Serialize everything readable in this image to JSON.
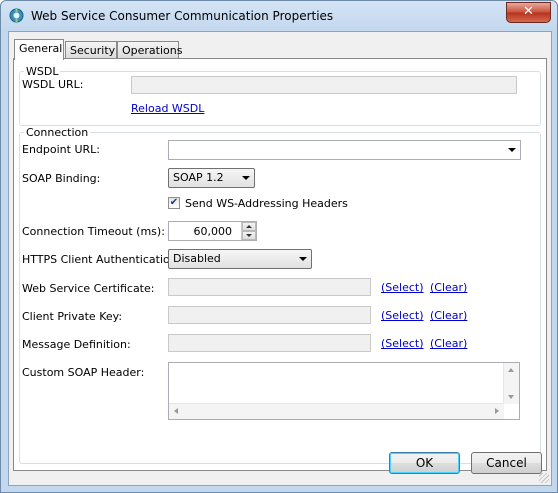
{
  "window": {
    "title": "Web Service Consumer Communication Properties",
    "close_label": "✕",
    "icon": "app-gear-icon"
  },
  "tabs": [
    {
      "label": "General",
      "active": true
    },
    {
      "label": "Security",
      "active": false
    },
    {
      "label": "Operations",
      "active": false
    }
  ],
  "wsdl": {
    "group_title": "WSDL",
    "url_label": "WSDL URL:",
    "url_value": "",
    "reload_link": "Reload WSDL"
  },
  "connection": {
    "group_title": "Connection",
    "endpoint_label": "Endpoint URL:",
    "endpoint_value": "",
    "soap_binding_label": "SOAP Binding:",
    "soap_binding_value": "SOAP 1.2",
    "ws_addressing_label": "Send WS-Addressing Headers",
    "ws_addressing_checked": true,
    "timeout_label": "Connection Timeout (ms):",
    "timeout_value": "60,000",
    "https_auth_label": "HTTPS Client Authentication:",
    "https_auth_value": "Disabled",
    "certificate_label": "Web Service Certificate:",
    "private_key_label": "Client Private Key:",
    "message_def_label": "Message Definition:",
    "select_link": "(Select)",
    "clear_link": "(Clear)",
    "custom_header_label": "Custom SOAP Header:",
    "custom_header_value": ""
  },
  "footer": {
    "ok_label": "OK",
    "cancel_label": "Cancel"
  }
}
